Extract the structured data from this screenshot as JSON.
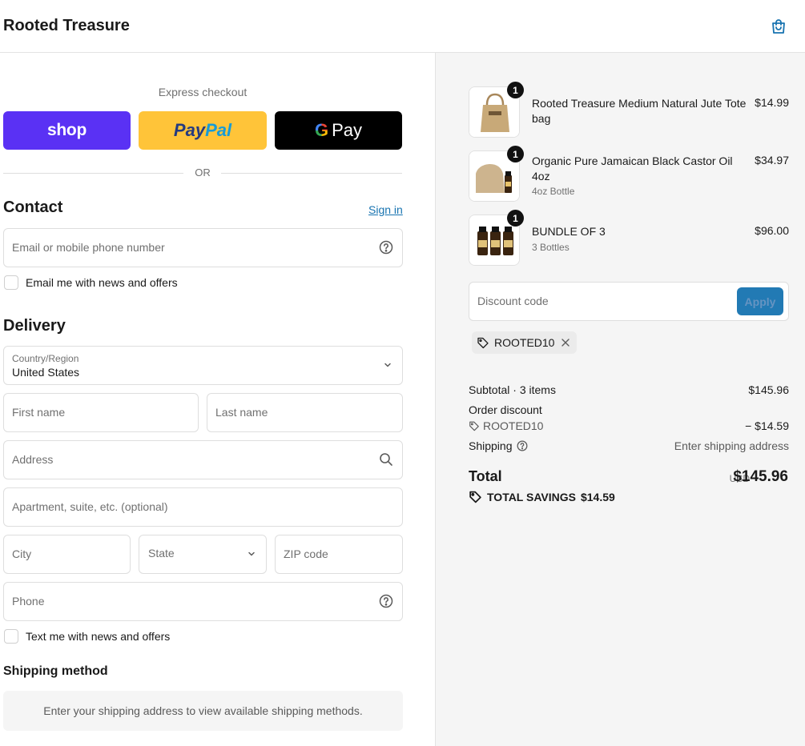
{
  "header": {
    "brand": "Rooted Treasure",
    "cart_icon": "shopping-bag-icon"
  },
  "express": {
    "label": "Express checkout",
    "shop_label": "shop",
    "paypal_label_1": "Pay",
    "paypal_label_2": "Pal",
    "gpay_label": "Pay",
    "or_label": "OR"
  },
  "contact": {
    "title": "Contact",
    "sign_in": "Sign in",
    "email_placeholder": "Email or mobile phone number",
    "email_opt_in": "Email me with news and offers"
  },
  "delivery": {
    "title": "Delivery",
    "country_label": "Country/Region",
    "country_value": "United States",
    "first_name": "First name",
    "last_name": "Last name",
    "address": "Address",
    "apartment": "Apartment, suite, etc. (optional)",
    "city": "City",
    "state": "State",
    "zip": "ZIP code",
    "phone": "Phone",
    "text_opt_in": "Text me with news and offers"
  },
  "shipping_method": {
    "title": "Shipping method",
    "message": "Enter your shipping address to view available shipping methods."
  },
  "order": {
    "items": [
      {
        "qty": "1",
        "name": "Rooted Treasure Medium Natural Jute Tote bag",
        "variant": "",
        "price": "$14.99"
      },
      {
        "qty": "1",
        "name": "Organic Pure Jamaican Black Castor Oil 4oz",
        "variant": "4oz Bottle",
        "price": "$34.97"
      },
      {
        "qty": "1",
        "name": "BUNDLE OF 3",
        "variant": "3 Bottles",
        "price": "$96.00"
      }
    ],
    "discount_placeholder": "Discount code",
    "apply_label": "Apply",
    "applied_code": "ROOTED10",
    "subtotal_label": "Subtotal · 3 items",
    "subtotal_value": "$145.96",
    "order_discount_label": "Order discount",
    "order_discount_code": "ROOTED10",
    "order_discount_value": "− $14.59",
    "shipping_label": "Shipping",
    "shipping_value": "Enter shipping address",
    "total_label": "Total",
    "total_currency": "USD",
    "total_value": "$145.96",
    "savings_label": "TOTAL SAVINGS",
    "savings_value": "$14.59"
  },
  "colors": {
    "shop": "#5a31f4",
    "paypal": "#ffc439",
    "gpay": "#000000",
    "link": "#1773b0",
    "panel": "#f5f5f5"
  }
}
